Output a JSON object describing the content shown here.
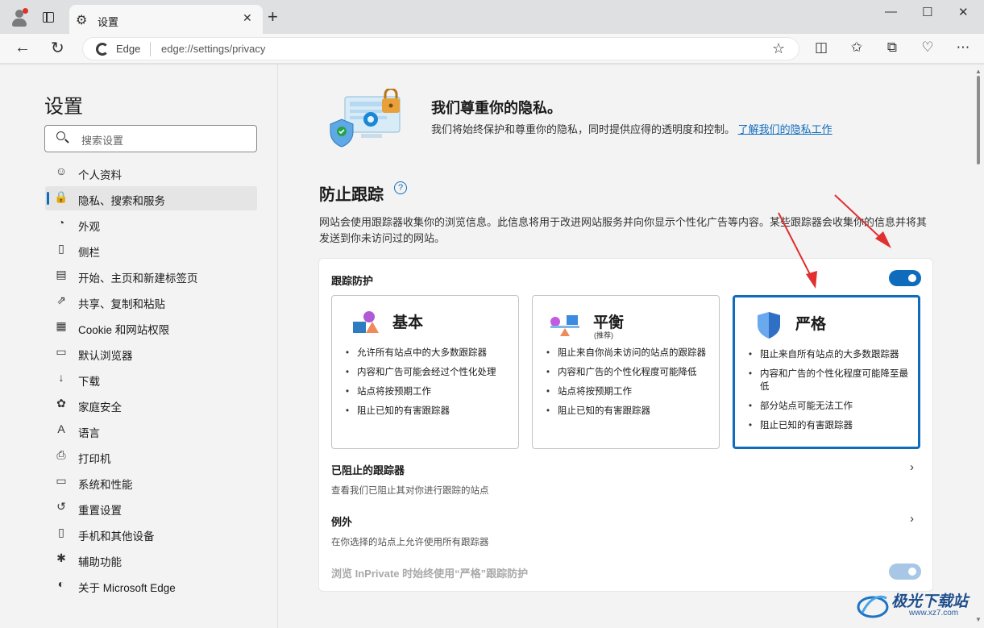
{
  "window": {
    "tab_title": "设置",
    "controls": {
      "minimize": "—",
      "maximize": "☐",
      "close": "✕"
    }
  },
  "address_bar": {
    "brand": "Edge",
    "url": "edge://settings/privacy"
  },
  "sidebar": {
    "title": "设置",
    "search_placeholder": "搜索设置",
    "items": [
      {
        "label": "个人资料",
        "icon": "profile-icon"
      },
      {
        "label": "隐私、搜索和服务",
        "icon": "lock-icon",
        "active": true
      },
      {
        "label": "外观",
        "icon": "palette-icon"
      },
      {
        "label": "侧栏",
        "icon": "sidebar-icon"
      },
      {
        "label": "开始、主页和新建标签页",
        "icon": "home-icon"
      },
      {
        "label": "共享、复制和粘贴",
        "icon": "share-icon"
      },
      {
        "label": "Cookie 和网站权限",
        "icon": "site-permissions-icon"
      },
      {
        "label": "默认浏览器",
        "icon": "browser-icon"
      },
      {
        "label": "下载",
        "icon": "download-icon"
      },
      {
        "label": "家庭安全",
        "icon": "family-icon"
      },
      {
        "label": "语言",
        "icon": "language-icon"
      },
      {
        "label": "打印机",
        "icon": "printer-icon"
      },
      {
        "label": "系统和性能",
        "icon": "laptop-icon"
      },
      {
        "label": "重置设置",
        "icon": "reset-icon"
      },
      {
        "label": "手机和其他设备",
        "icon": "phone-icon"
      },
      {
        "label": "辅助功能",
        "icon": "accessibility-icon"
      },
      {
        "label": "关于 Microsoft Edge",
        "icon": "edge-icon"
      }
    ]
  },
  "hero": {
    "title": "我们尊重你的隐私。",
    "desc": "我们将始终保护和尊重你的隐私，同时提供应得的透明度和控制。",
    "link": "了解我们的隐私工作"
  },
  "tracking": {
    "title": "防止跟踪",
    "help": "?",
    "desc": "网站会使用跟踪器收集你的浏览信息。此信息将用于改进网站服务并向你显示个性化广告等内容。某些跟踪器会收集你的信息并将其发送到你未访问过的网站。",
    "protection_label": "跟踪防护",
    "protection_on": true,
    "options": [
      {
        "name": "基本",
        "sub": "",
        "bullets": [
          "允许所有站点中的大多数跟踪器",
          "内容和广告可能会经过个性化处理",
          "站点将按预期工作",
          "阻止已知的有害跟踪器"
        ]
      },
      {
        "name": "平衡",
        "sub": "(推荐)",
        "bullets": [
          "阻止来自你尚未访问的站点的跟踪器",
          "内容和广告的个性化程度可能降低",
          "站点将按预期工作",
          "阻止已知的有害跟踪器"
        ]
      },
      {
        "name": "严格",
        "sub": "",
        "selected": true,
        "bullets": [
          "阻止来自所有站点的大多数跟踪器",
          "内容和广告的个性化程度可能降至最低",
          "部分站点可能无法工作",
          "阻止已知的有害跟踪器"
        ]
      }
    ],
    "blocked": {
      "title": "已阻止的跟踪器",
      "sub": "查看我们已阻止其对你进行跟踪的站点"
    },
    "exceptions": {
      "title": "例外",
      "sub": "在你选择的站点上允许使用所有跟踪器"
    },
    "inprivate": {
      "title": "浏览 InPrivate 时始终使用“严格”跟踪防护",
      "on": true
    }
  },
  "watermark": {
    "text": "极光下载站",
    "url": "www.xz7.com"
  },
  "colors": {
    "accent": "#0f6cbd",
    "annotation_arrow": "#e03030"
  }
}
